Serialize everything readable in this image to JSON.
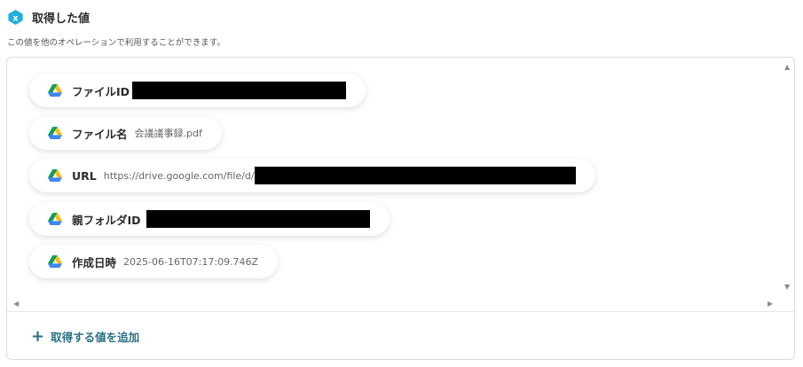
{
  "header": {
    "title": "取得した値",
    "subtitle": "この値を他のオペレーションで利用することができます。"
  },
  "fields": [
    {
      "label": "ファイルID",
      "value": "",
      "redacted": true
    },
    {
      "label": "ファイル名",
      "value": "会議議事録.pdf",
      "redacted": false
    },
    {
      "label": "URL",
      "value": "https://drive.google.com/file/d/",
      "redacted": true
    },
    {
      "label": "親フォルダID",
      "value": "",
      "redacted": true
    },
    {
      "label": "作成日時",
      "value": "2025-06-16T07:17:09.746Z",
      "redacted": false
    }
  ],
  "footer": {
    "add_label": "取得する値を追加"
  },
  "colors": {
    "accent": "#2a6f84",
    "badge": "#1fb0d9"
  },
  "icons": {
    "header": "x-badge-icon",
    "field": "google-drive-icon",
    "add": "plus-icon"
  }
}
